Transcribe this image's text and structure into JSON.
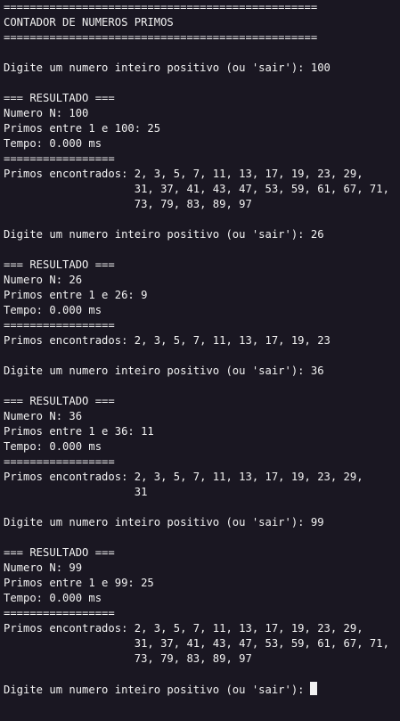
{
  "header": {
    "rule": "================================================",
    "title": "CONTADOR DE NUMEROS PRIMOS"
  },
  "lines": [
    {
      "kind": "rule",
      "text": "================================================"
    },
    {
      "kind": "title",
      "text": "CONTADOR DE NUMEROS PRIMOS"
    },
    {
      "kind": "rule",
      "text": "================================================"
    },
    {
      "kind": "blank",
      "text": ""
    },
    {
      "kind": "prompt",
      "text": "Digite um numero inteiro positivo (ou 'sair'): 100"
    },
    {
      "kind": "blank",
      "text": ""
    },
    {
      "kind": "result-header",
      "text": "=== RESULTADO ==="
    },
    {
      "kind": "result",
      "text": "Numero N: 100"
    },
    {
      "kind": "result",
      "text": "Primos entre 1 e 100: 25"
    },
    {
      "kind": "result",
      "text": "Tempo: 0.000 ms"
    },
    {
      "kind": "rule-short",
      "text": "================="
    },
    {
      "kind": "primes",
      "text": "Primos encontrados: 2, 3, 5, 7, 11, 13, 17, 19, 23, 29,"
    },
    {
      "kind": "primes",
      "text": "                    31, 37, 41, 43, 47, 53, 59, 61, 67, 71,"
    },
    {
      "kind": "primes",
      "text": "                    73, 79, 83, 89, 97"
    },
    {
      "kind": "blank",
      "text": ""
    },
    {
      "kind": "prompt",
      "text": "Digite um numero inteiro positivo (ou 'sair'): 26"
    },
    {
      "kind": "blank",
      "text": ""
    },
    {
      "kind": "result-header",
      "text": "=== RESULTADO ==="
    },
    {
      "kind": "result",
      "text": "Numero N: 26"
    },
    {
      "kind": "result",
      "text": "Primos entre 1 e 26: 9"
    },
    {
      "kind": "result",
      "text": "Tempo: 0.000 ms"
    },
    {
      "kind": "rule-short",
      "text": "================="
    },
    {
      "kind": "primes",
      "text": "Primos encontrados: 2, 3, 5, 7, 11, 13, 17, 19, 23"
    },
    {
      "kind": "blank",
      "text": ""
    },
    {
      "kind": "prompt",
      "text": "Digite um numero inteiro positivo (ou 'sair'): 36"
    },
    {
      "kind": "blank",
      "text": ""
    },
    {
      "kind": "result-header",
      "text": "=== RESULTADO ==="
    },
    {
      "kind": "result",
      "text": "Numero N: 36"
    },
    {
      "kind": "result",
      "text": "Primos entre 1 e 36: 11"
    },
    {
      "kind": "result",
      "text": "Tempo: 0.000 ms"
    },
    {
      "kind": "rule-short",
      "text": "================="
    },
    {
      "kind": "primes",
      "text": "Primos encontrados: 2, 3, 5, 7, 11, 13, 17, 19, 23, 29,"
    },
    {
      "kind": "primes",
      "text": "                    31"
    },
    {
      "kind": "blank",
      "text": ""
    },
    {
      "kind": "prompt",
      "text": "Digite um numero inteiro positivo (ou 'sair'): 99"
    },
    {
      "kind": "blank",
      "text": ""
    },
    {
      "kind": "result-header",
      "text": "=== RESULTADO ==="
    },
    {
      "kind": "result",
      "text": "Numero N: 99"
    },
    {
      "kind": "result",
      "text": "Primos entre 1 e 99: 25"
    },
    {
      "kind": "result",
      "text": "Tempo: 0.000 ms"
    },
    {
      "kind": "rule-short",
      "text": "================="
    },
    {
      "kind": "primes",
      "text": "Primos encontrados: 2, 3, 5, 7, 11, 13, 17, 19, 23, 29,"
    },
    {
      "kind": "primes",
      "text": "                    31, 37, 41, 43, 47, 53, 59, 61, 67, 71,"
    },
    {
      "kind": "primes",
      "text": "                    73, 79, 83, 89, 97"
    },
    {
      "kind": "blank",
      "text": ""
    }
  ],
  "input_prompt": "Digite um numero inteiro positivo (ou 'sair'):",
  "colors": {
    "background": "#1a1722",
    "foreground": "#f2f2f2"
  }
}
